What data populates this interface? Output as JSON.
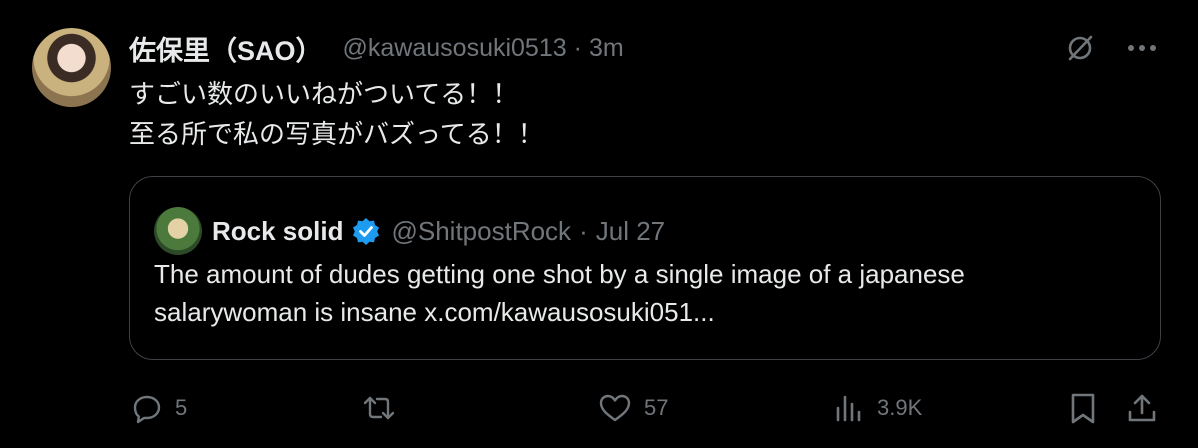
{
  "tweet": {
    "author_name": "佐保里（SAO）",
    "author_handle": "@kawausosuki0513",
    "separator": "·",
    "time": "3m",
    "text_lines": [
      "すごい数のいいねがついてる！！",
      "至る所で私の写真がバズってる！！"
    ]
  },
  "quote": {
    "author_name": "Rock solid",
    "author_handle": "@ShitpostRock",
    "separator": "·",
    "date": "Jul 27",
    "text_lines": [
      "The amount of dudes getting one shot by a single image of a japanese",
      "salarywoman is insane x.com/kawausosuki051..."
    ],
    "verified_color": "#1d9bf0"
  },
  "actions": {
    "replies": "5",
    "reposts": "",
    "likes": "57",
    "views": "3.9K"
  },
  "icons": {
    "top": [
      "grok-slash-icon",
      "more-icon"
    ],
    "actions": [
      "reply-icon",
      "repost-icon",
      "like-icon",
      "views-icon",
      "bookmark-icon",
      "share-icon"
    ]
  },
  "colors": {
    "background": "#000000",
    "primary_text": "#e7e9ea",
    "secondary_text": "#71767b",
    "border": "#3d4146"
  }
}
